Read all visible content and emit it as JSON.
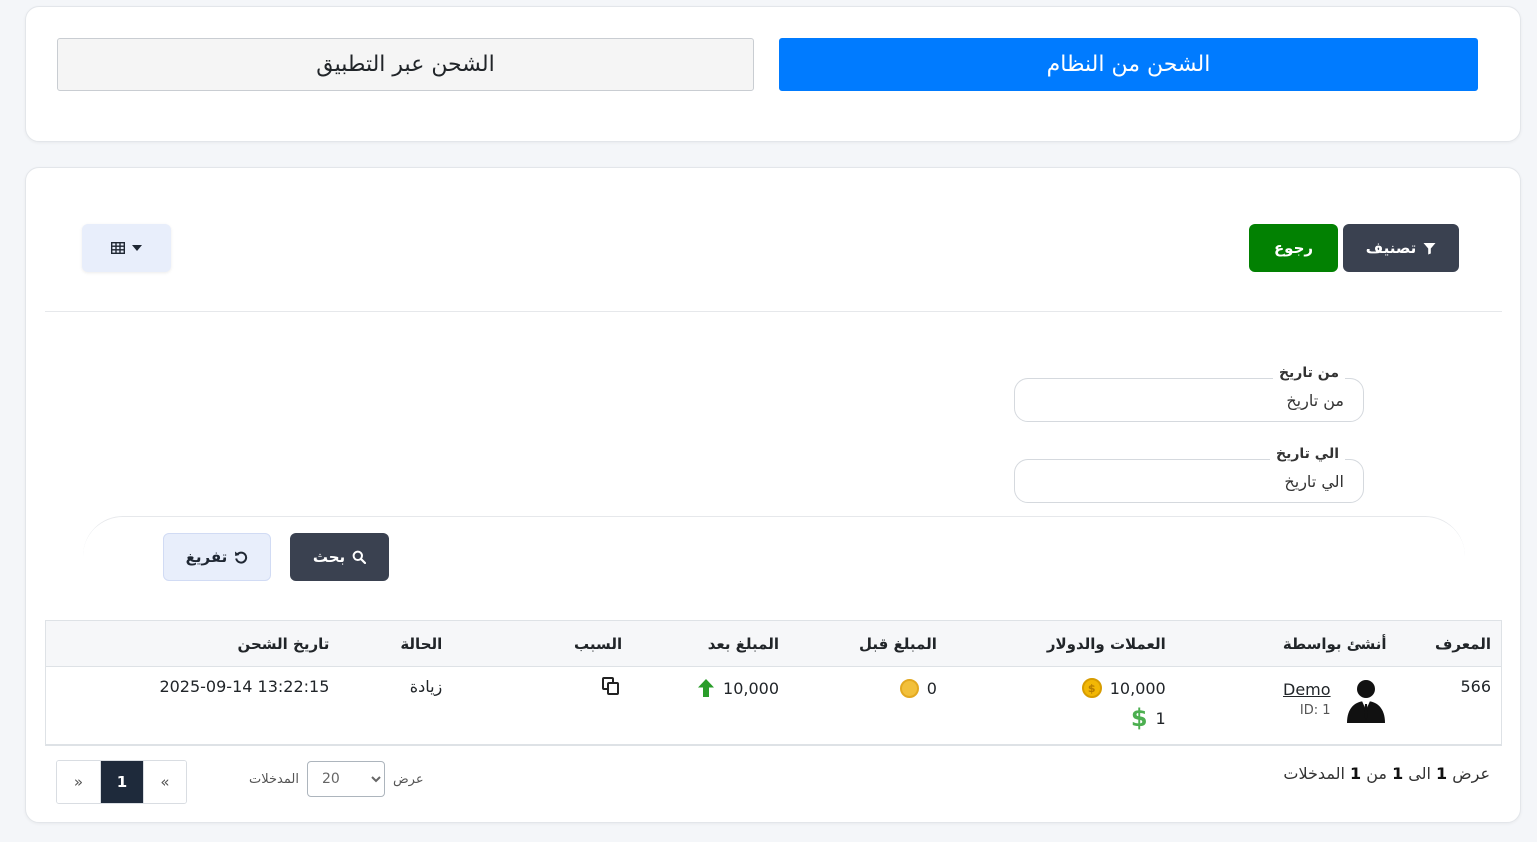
{
  "top": {
    "system_charge": "الشحن من النظام",
    "app_charge": "الشحن عبر التطبيق"
  },
  "toolbar": {
    "filter": "تصنيف",
    "back": "رجوع"
  },
  "filters": {
    "from_label": "من تاريخ",
    "from_placeholder": "من تاريخ",
    "to_label": "الي تاريخ",
    "to_placeholder": "الي تاريخ",
    "search": "بحث",
    "reset": "تفريغ"
  },
  "table": {
    "headers": {
      "id": "المعرف",
      "created_by": "أنشئ بواسطة",
      "amounts": "العملات والدولار",
      "before": "المبلغ قبل",
      "after": "المبلغ بعد",
      "reason": "السبب",
      "status": "الحالة",
      "date": "تاريخ الشحن"
    },
    "rows": [
      {
        "id": "566",
        "user_name": "Demo",
        "user_id": "ID: 1",
        "coins": "10,000",
        "dollars": "1",
        "before": "0",
        "after": "10,000",
        "status": "زيادة",
        "date": "2025-09-14 13:22:15"
      }
    ]
  },
  "pagination": {
    "prefix": "عرض",
    "start": "1",
    "to_word": "الى",
    "end": "1",
    "of_word": "من",
    "total": "1",
    "suffix": "المدخلات",
    "show_label": "عرض",
    "page_size": "20",
    "entries_label": "المدخلات",
    "prev": "«",
    "current": "1",
    "next": "»"
  },
  "colors": {
    "primary": "#007bff",
    "dark_button": "#3a4150",
    "back_button": "#028102",
    "up_arrow": "#2a9d2a"
  }
}
